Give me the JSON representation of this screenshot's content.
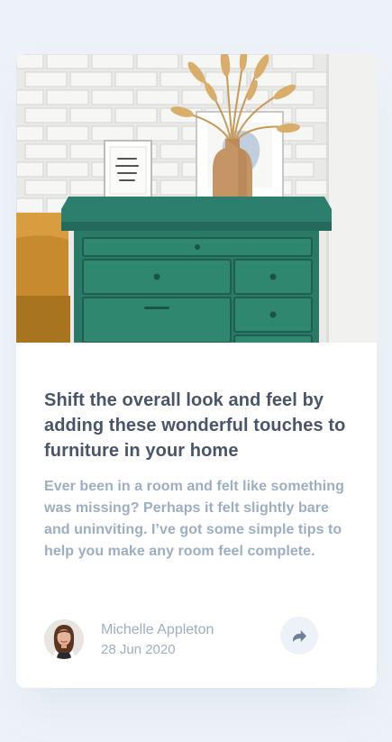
{
  "article": {
    "title": "Shift the overall look and feel by adding these wonderful touches to furniture in your home",
    "description": "Ever been in a room and felt like something was missing? Perhaps it felt slightly bare and uninviting. I’ve got some simple tips to help you make any room feel complete.",
    "image_icon": "drawers-photo"
  },
  "author": {
    "name": "Michelle Appleton",
    "date": "28 Jun 2020",
    "avatar_icon": "avatar-photo"
  },
  "share": {
    "icon": "share-arrow-icon"
  },
  "colors": {
    "page_background": "#ecf2f8",
    "card_background": "#ffffff",
    "title_text": "#48556a",
    "body_text": "#9daec2",
    "share_button": "#ecf2f8",
    "share_icon": "#6e8098"
  }
}
